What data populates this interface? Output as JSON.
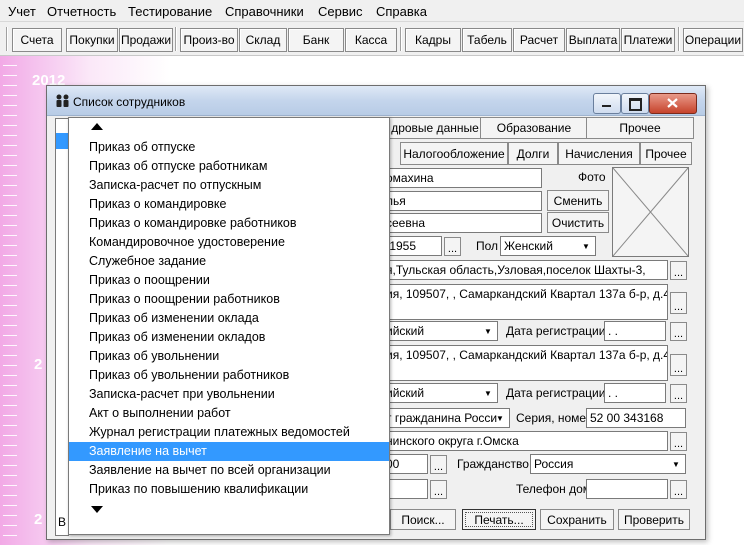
{
  "menu": [
    "Учет",
    "Отчетность",
    "Тестирование",
    "Справочники",
    "Сервис",
    "Справка"
  ],
  "toolbar": [
    "Счета",
    "Покупки",
    "Продажи",
    "Произ-во",
    "Склад",
    "Банк",
    "Касса",
    "Кадры",
    "Табель",
    "Расчет",
    "Выплата",
    "Платежи",
    "Операции"
  ],
  "desktop": {
    "year_top": "2012",
    "year_mid": "2",
    "year_bottom": "2"
  },
  "window": {
    "title": "Список сотрудников",
    "tabs_row1": [
      "дровые данные",
      "Образование",
      "Прочее"
    ],
    "tabs_row2": [
      "Налогообложение",
      "Долги",
      "Начисления",
      "Прочее"
    ],
    "surname": "омахина",
    "name": "лья",
    "patronymic": "сеевна",
    "photo_label": "Фото",
    "change_button": "Сменить",
    "clear_button": "Очистить",
    "birth_date": ".1955",
    "sex_label": "Пол",
    "sex_value": "Женский",
    "birth_place": "я,Тульская область,Узловая,поселок Шахты-3,",
    "address1": "ия, 109507, , Самаркандский Квартал 137а б-р, д.4,",
    "region1": "ийский",
    "reg_date_label": "Дата регистрации",
    "reg_date_value": " .  .",
    "address2": "ия, 109507, , Самаркандский Квартал 137а б-р, д.4,",
    "region2": "ийский",
    "doc_type": "т гражданина Росси",
    "series_label": "Серия, номер",
    "series_value": "52 00 343168",
    "issued_by": "нинского округа г.Омска",
    "code_value": "00",
    "citizenship_label": "Гражданство",
    "citizenship_value": "Россия",
    "phone_label": "Телефон дом",
    "bottom_left_label": "В",
    "buttons": [
      "Поиск...",
      "Печать...",
      "Сохранить",
      "Проверить"
    ]
  },
  "popup": {
    "items": [
      "Приказ об отпуске",
      "Приказ об отпуске работникам",
      "Записка-расчет по отпускным",
      "Приказ о командировке",
      "Приказ о командировке работников",
      "Командировочное удостоверение",
      "Служебное задание",
      "Приказ о поощрении",
      "Приказ о поощрении работников",
      "Приказ об изменении оклада",
      "Приказ об изменении окладов",
      "Приказ об увольнении",
      "Приказ об увольнении работников",
      "Записка-расчет при увольнении",
      "Акт о выполнении работ",
      "Журнал регистрации платежных ведомостей",
      "Заявление на вычет",
      "Заявление на вычет по всей организации",
      "Приказ по повышению квалификации"
    ],
    "selected": "Заявление на вычет"
  },
  "colors": {
    "selection": "#3399ff",
    "desktop_pink": "#f2a9e6"
  }
}
